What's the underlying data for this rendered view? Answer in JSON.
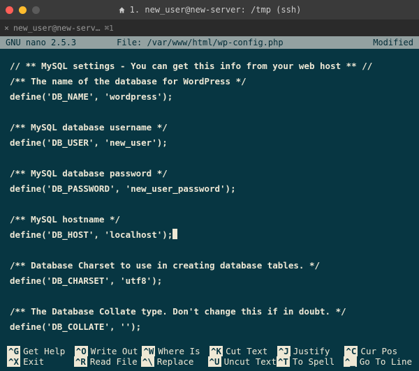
{
  "window": {
    "title": "1. new_user@new-server: /tmp (ssh)"
  },
  "tab": {
    "label": "new_user@new-serv…",
    "shortcut": "⌘1"
  },
  "nano": {
    "status_left": "GNU nano 2.5.3",
    "status_file": "File: /var/www/html/wp-config.php",
    "status_right": "Modified"
  },
  "editor_lines": [
    "// ** MySQL settings - You can get this info from your web host ** //",
    "/** The name of the database for WordPress */",
    "define('DB_NAME', 'wordpress');",
    "",
    "/** MySQL database username */",
    "define('DB_USER', 'new_user');",
    "",
    "/** MySQL database password */",
    "define('DB_PASSWORD', 'new_user_password');",
    "",
    "/** MySQL hostname */",
    "define('DB_HOST', 'localhost');",
    "",
    "/** Database Charset to use in creating database tables. */",
    "define('DB_CHARSET', 'utf8');",
    "",
    "/** The Database Collate type. Don't change this if in doubt. */",
    "define('DB_COLLATE', '');"
  ],
  "cursor_line": 11,
  "shortcuts": {
    "row1": [
      {
        "key": "^G",
        "label": "Get Help"
      },
      {
        "key": "^O",
        "label": "Write Out"
      },
      {
        "key": "^W",
        "label": "Where Is"
      },
      {
        "key": "^K",
        "label": "Cut Text"
      },
      {
        "key": "^J",
        "label": "Justify"
      },
      {
        "key": "^C",
        "label": "Cur Pos"
      }
    ],
    "row2": [
      {
        "key": "^X",
        "label": "Exit"
      },
      {
        "key": "^R",
        "label": "Read File"
      },
      {
        "key": "^\\",
        "label": "Replace"
      },
      {
        "key": "^U",
        "label": "Uncut Text"
      },
      {
        "key": "^T",
        "label": "To Spell"
      },
      {
        "key": "^_",
        "label": "Go To Line"
      }
    ]
  }
}
